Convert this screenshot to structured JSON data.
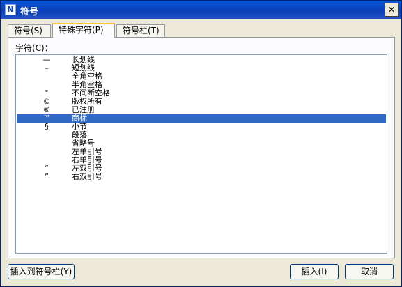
{
  "window": {
    "title": "符号",
    "close_label": "✕",
    "app_icon_glyph": "N"
  },
  "tabs": [
    {
      "label": "符号(S)"
    },
    {
      "label": "特殊字符(P)"
    },
    {
      "label": "符号栏(T)"
    }
  ],
  "active_tab": "特殊字符(P)",
  "list": {
    "label": "字符(C)：",
    "selected_index": 7,
    "items": [
      {
        "symbol": "—",
        "name": "长划线"
      },
      {
        "symbol": "–",
        "name": "短划线"
      },
      {
        "symbol": "",
        "name": "全角空格"
      },
      {
        "symbol": "",
        "name": "半角空格"
      },
      {
        "symbol": "°",
        "name": "不间断空格"
      },
      {
        "symbol": "©",
        "name": "版权所有"
      },
      {
        "symbol": "®",
        "name": "已注册"
      },
      {
        "symbol": "™",
        "name": "商标"
      },
      {
        "symbol": "§",
        "name": "小节"
      },
      {
        "symbol": "",
        "name": "段落"
      },
      {
        "symbol": "",
        "name": "省略号"
      },
      {
        "symbol": "",
        "name": "左单引号"
      },
      {
        "symbol": "",
        "name": "右单引号"
      },
      {
        "symbol": "“",
        "name": "左双引号"
      },
      {
        "symbol": "”",
        "name": "右双引号"
      }
    ]
  },
  "buttons": {
    "insert_to_bar": "插入到符号栏(Y)",
    "insert": "插入(I)",
    "cancel": "取消"
  },
  "colors": {
    "title_bar": "#0b3fb7",
    "selection": "#316ac5",
    "dialog_bg": "#ece9d8"
  }
}
